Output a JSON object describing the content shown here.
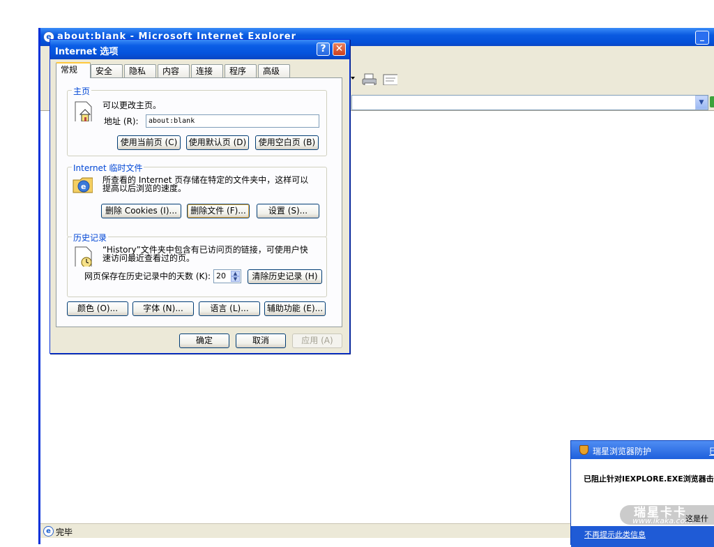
{
  "ie_window": {
    "title": "about:blank - Microsoft Internet Explorer",
    "status_text": "完毕"
  },
  "dialog": {
    "title": "Internet 选项",
    "tabs": [
      {
        "label": "常规",
        "active": true
      },
      {
        "label": "安全"
      },
      {
        "label": "隐私"
      },
      {
        "label": "内容"
      },
      {
        "label": "连接"
      },
      {
        "label": "程序"
      },
      {
        "label": "高级"
      }
    ],
    "home": {
      "legend": "主页",
      "description": "可以更改主页。",
      "address_label": "地址 (R):",
      "address_value": "about:blank",
      "use_current": "使用当前页 (C)",
      "use_default": "使用默认页 (D)",
      "use_blank": "使用空白页 (B)"
    },
    "temp_files": {
      "legend": "Internet 临时文件",
      "description_line1": "所查看的 Internet 页存储在特定的文件夹中，这样可以",
      "description_line2": "提高以后浏览的速度。",
      "delete_cookies": "删除 Cookies (I)...",
      "delete_files": "删除文件 (F)...",
      "settings": "设置 (S)..."
    },
    "history": {
      "legend": "历史记录",
      "description_line1": "“History”文件夹中包含有已访问页的链接，可使用户快",
      "description_line2": "速访问最近查看过的页。",
      "days_label": "网页保存在历史记录中的天数 (K):",
      "days_value": "20",
      "clear_history": "清除历史记录 (H)"
    },
    "bottom_buttons": {
      "colors": "颜色 (O)...",
      "fonts": "字体 (N)...",
      "languages": "语言 (L)...",
      "accessibility": "辅助功能 (E)..."
    },
    "ok": "确定",
    "cancel": "取消",
    "apply": "应用 (A)"
  },
  "popup": {
    "title": "瑞星浏览器防护",
    "close_partial": "巳",
    "message": "已阻止针对IEXPLORE.EXE浏览器击",
    "watermark_brand": "瑞星卡卡",
    "watermark_url": "www.ikaka.com",
    "extra_text": "这是什",
    "dont_show": "不再提示此类信息"
  },
  "colors": {
    "xp_blue": "#0a5ae0",
    "dialog_face": "#ece9d8",
    "group_legend": "#0046d5"
  }
}
